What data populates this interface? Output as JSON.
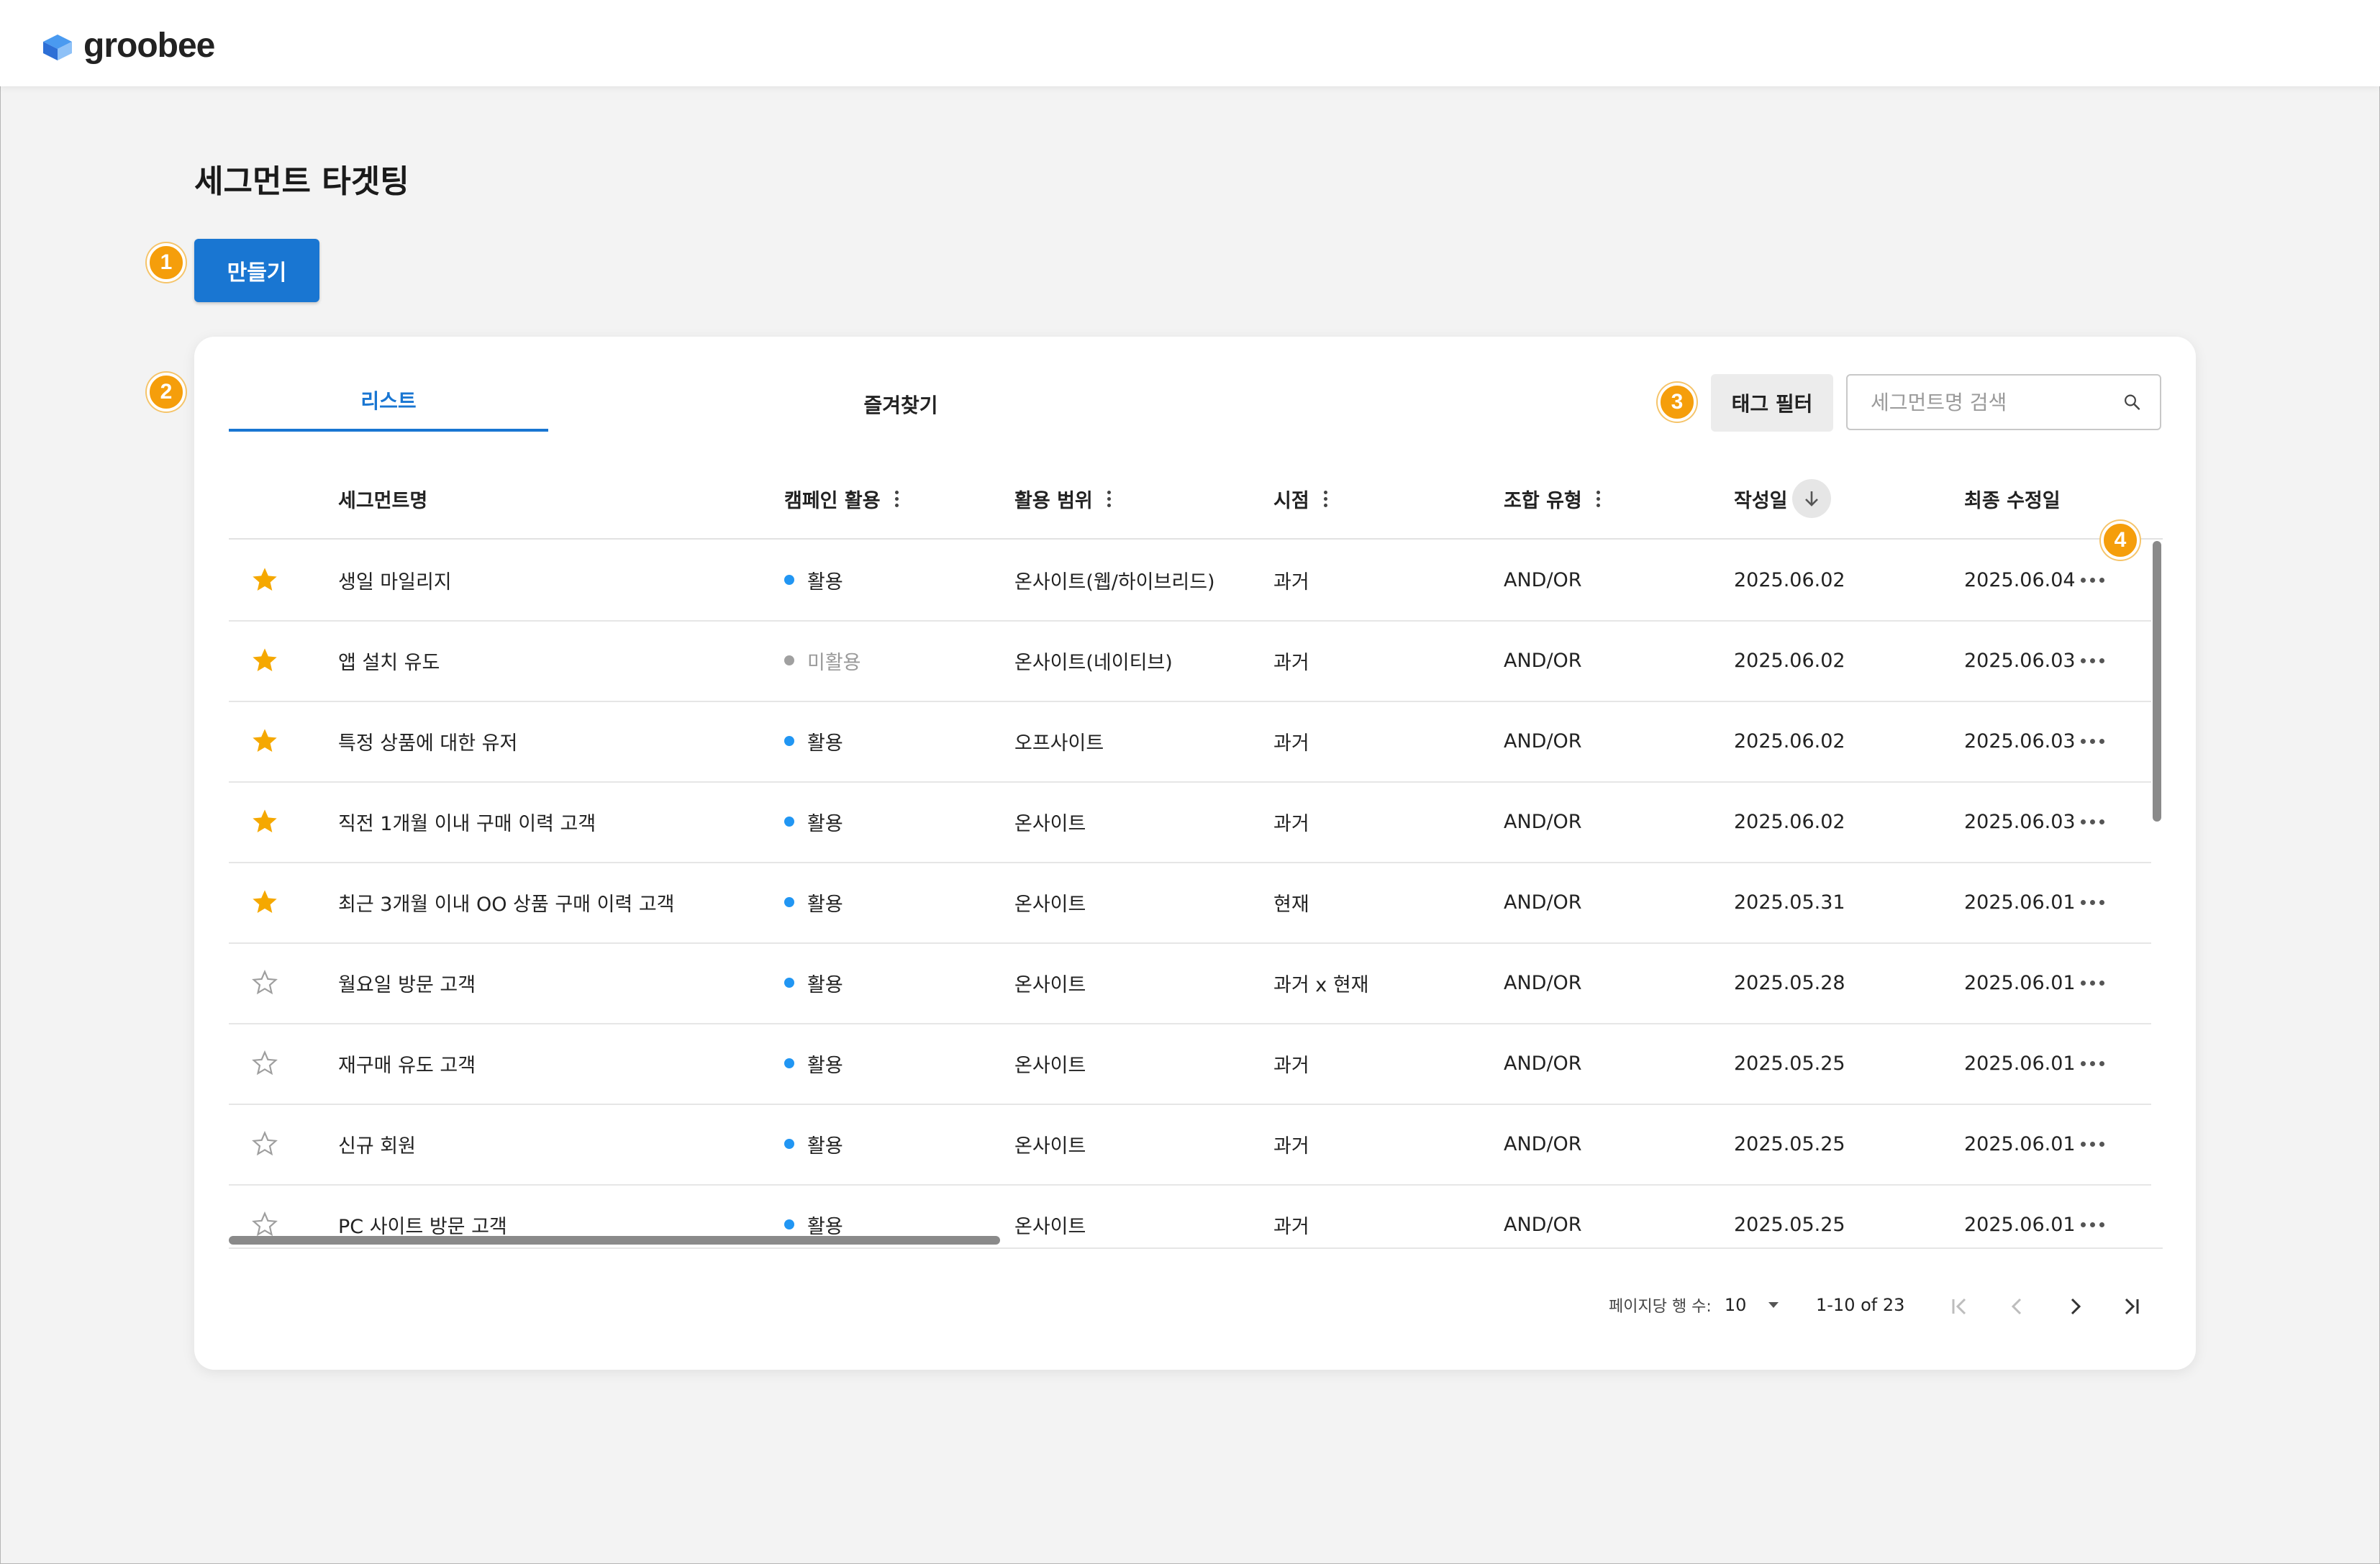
{
  "app": {
    "logo_text": "groobee"
  },
  "page": {
    "title": "세그먼트 타겟팅",
    "create_label": "만들기"
  },
  "markers": [
    "1",
    "2",
    "3",
    "4"
  ],
  "tabs": [
    {
      "label": "리스트",
      "active": true
    },
    {
      "label": "즐겨찾기",
      "active": false
    }
  ],
  "toolbar": {
    "tag_filter_label": "태그 필터",
    "search_placeholder": "세그먼트명 검색"
  },
  "columns": {
    "name": "세그먼트명",
    "campaign": "캠페인 활용",
    "scope": "활용 범위",
    "time": "시점",
    "combo": "조합 유형",
    "created": "작성일",
    "modified": "최종 수정일"
  },
  "rows": [
    {
      "favorite": true,
      "name": "생일 마일리지",
      "campaign": "활용",
      "active": true,
      "scope": "온사이트(웹/하이브리드)",
      "time": "과거",
      "combo": "AND/OR",
      "created": "2025.06.02",
      "modified": "2025.06.04"
    },
    {
      "favorite": true,
      "name": "앱 설치 유도",
      "campaign": "미활용",
      "active": false,
      "scope": "온사이트(네이티브)",
      "time": "과거",
      "combo": "AND/OR",
      "created": "2025.06.02",
      "modified": "2025.06.03"
    },
    {
      "favorite": true,
      "name": "특정 상품에 대한 유저",
      "campaign": "활용",
      "active": true,
      "scope": "오프사이트",
      "time": "과거",
      "combo": "AND/OR",
      "created": "2025.06.02",
      "modified": "2025.06.03"
    },
    {
      "favorite": true,
      "name": "직전 1개월 이내 구매 이력 고객",
      "campaign": "활용",
      "active": true,
      "scope": "온사이트",
      "time": "과거",
      "combo": "AND/OR",
      "created": "2025.06.02",
      "modified": "2025.06.03"
    },
    {
      "favorite": true,
      "name": "최근 3개월 이내 OO 상품 구매 이력 고객",
      "campaign": "활용",
      "active": true,
      "scope": "온사이트",
      "time": "현재",
      "combo": "AND/OR",
      "created": "2025.05.31",
      "modified": "2025.06.01"
    },
    {
      "favorite": false,
      "name": "월요일 방문 고객",
      "campaign": "활용",
      "active": true,
      "scope": "온사이트",
      "time": "과거 x 현재",
      "combo": "AND/OR",
      "created": "2025.05.28",
      "modified": "2025.06.01"
    },
    {
      "favorite": false,
      "name": "재구매 유도 고객",
      "campaign": "활용",
      "active": true,
      "scope": "온사이트",
      "time": "과거",
      "combo": "AND/OR",
      "created": "2025.05.25",
      "modified": "2025.06.01"
    },
    {
      "favorite": false,
      "name": "신규 회원",
      "campaign": "활용",
      "active": true,
      "scope": "온사이트",
      "time": "과거",
      "combo": "AND/OR",
      "created": "2025.05.25",
      "modified": "2025.06.01"
    },
    {
      "favorite": false,
      "name": "PC 사이트 방문 고객",
      "campaign": "활용",
      "active": true,
      "scope": "온사이트",
      "time": "과거",
      "combo": "AND/OR",
      "created": "2025.05.25",
      "modified": "2025.06.01"
    }
  ],
  "pagination": {
    "rows_per_page_label": "페이지당 행 수:",
    "rows_per_page": "10",
    "range": "1-10 of 23"
  },
  "colors": {
    "accent": "#1976d2",
    "active_dot": "#2196f3",
    "inactive_dot": "#a0a0a0",
    "star": "#f5a800",
    "marker": "#f59e0b"
  },
  "icons": {
    "search": "search-icon",
    "star_filled": "star-filled-icon",
    "star_outline": "star-outline-icon",
    "more": "more-horizontal-icon",
    "sort": "arrow-down-icon",
    "kebab": "more-vertical-icon"
  }
}
